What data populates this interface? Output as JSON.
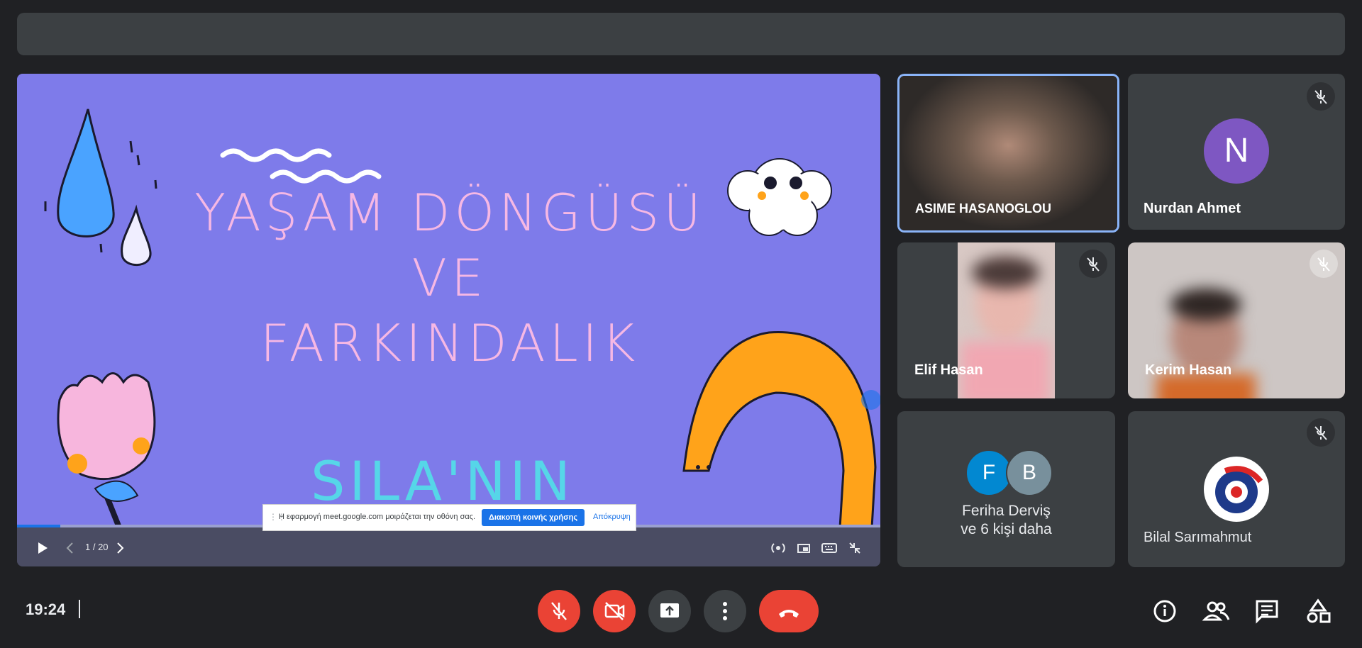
{
  "presentation": {
    "slide_title_line1": "YAŞAM DÖNGÜSÜ VE",
    "slide_title_line2": "FARKINDALIK",
    "slide_subtitle": "SILA'NIN MEKTUBU",
    "page_counter": "1 / 20",
    "progress": 0.05,
    "share_banner": {
      "message": "Η εφαρμογή meet.google.com μοιράζεται την οθόνη σας.",
      "stop_label": "Διακοπή κοινής χρήσης",
      "hide_label": "Απόκρυψη"
    }
  },
  "participants": [
    {
      "name": "ASIME HASANOGLOU",
      "muted": false,
      "active_speaker": true
    },
    {
      "name": "Nurdan Ahmet",
      "muted": true,
      "avatar_letter": "N",
      "avatar_color": "#7e57c2"
    },
    {
      "name": "Elif Hasan",
      "muted": true
    },
    {
      "name": "Kerim Hasan",
      "muted": true
    },
    {
      "group_label_line1": "Feriha Derviş",
      "group_label_line2": "ve 6 kişi daha",
      "avatars": [
        "F",
        "B"
      ],
      "avatar_colors": [
        "#0288d1",
        "#78909c"
      ]
    },
    {
      "name": "Bilal Sarımahmut",
      "muted": true
    }
  ],
  "bottom_bar": {
    "time": "19:24",
    "buttons": [
      "mic-off",
      "camera-off",
      "present-screen",
      "more-options",
      "leave-call"
    ],
    "side_buttons": [
      "info",
      "people",
      "chat",
      "activities"
    ]
  },
  "colors": {
    "accent": "#8ab4f8",
    "danger": "#ea4335",
    "surface": "#3c4043",
    "background": "#202124"
  }
}
